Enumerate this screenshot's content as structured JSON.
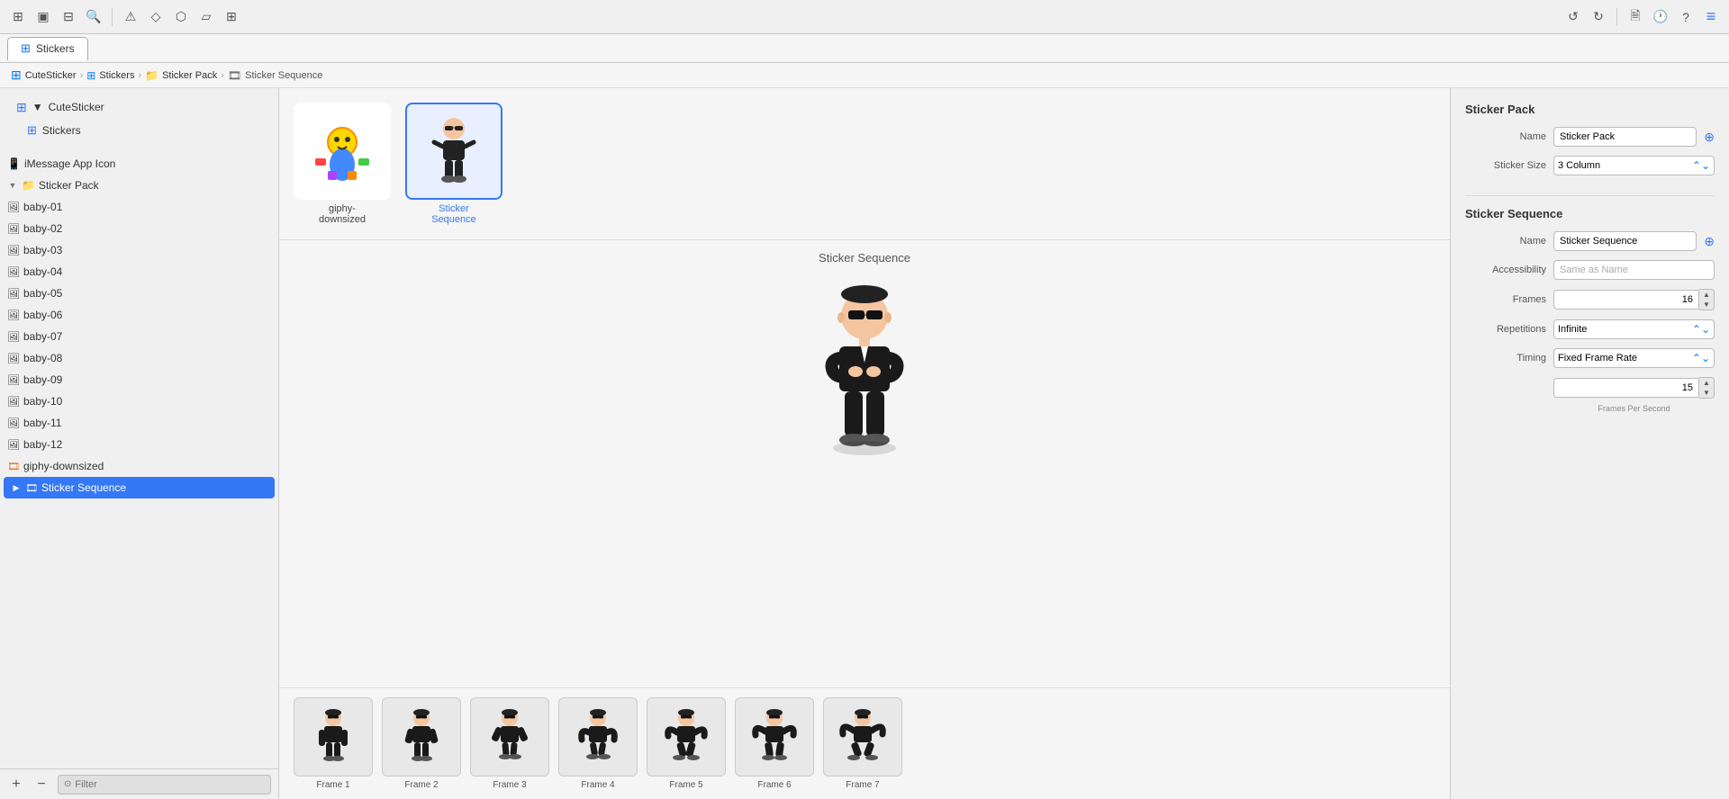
{
  "app": {
    "title": "CuteSticker"
  },
  "toolbar": {
    "icons": [
      "square-icon",
      "window-icon",
      "panel-icon",
      "search-icon",
      "warning-icon",
      "diamond-icon",
      "brush-icon",
      "rect-icon",
      "grid-icon"
    ]
  },
  "tabs": [
    {
      "id": "stickers",
      "label": "Stickers",
      "active": true
    }
  ],
  "breadcrumb": {
    "items": [
      "CuteSticker",
      "Stickers",
      "Sticker Pack",
      "Sticker Sequence"
    ]
  },
  "nav": {
    "cute_sticker_label": "CuteSticker",
    "stickers_label": "Stickers"
  },
  "tree": {
    "imessage_label": "iMessage App Icon",
    "sticker_pack_label": "Sticker Pack",
    "items": [
      "baby-01",
      "baby-02",
      "baby-03",
      "baby-04",
      "baby-05",
      "baby-06",
      "baby-07",
      "baby-08",
      "baby-09",
      "baby-10",
      "baby-11",
      "baby-12",
      "giphy-downsized",
      "Sticker Sequence"
    ]
  },
  "asset_grid": {
    "items": [
      {
        "id": "giphy",
        "label": "giphy-\ndownsized",
        "selected": false
      },
      {
        "id": "sticker-seq",
        "label": "Sticker\nSequence",
        "selected": true
      }
    ]
  },
  "preview": {
    "title": "Sticker Sequence"
  },
  "frames": [
    "Frame 1",
    "Frame 2",
    "Frame 3",
    "Frame 4",
    "Frame 5",
    "Frame 6",
    "Frame 7"
  ],
  "right_panel": {
    "sticker_pack_section": "Sticker Pack",
    "name_label": "Name",
    "name_value": "Sticker Pack",
    "sticker_size_label": "Sticker Size",
    "sticker_size_value": "3 Column",
    "sticker_sequence_section": "Sticker Sequence",
    "seq_name_label": "Name",
    "seq_name_value": "Sticker Sequence",
    "accessibility_label": "Accessibility",
    "accessibility_placeholder": "Same as Name",
    "frames_label": "Frames",
    "frames_value": "16",
    "repetitions_label": "Repetitions",
    "repetitions_value": "Infinite",
    "timing_label": "Timing",
    "timing_value": "Fixed Frame Rate",
    "fps_value": "15",
    "fps_label": "Frames Per Second"
  },
  "filter": {
    "placeholder": "Filter"
  },
  "colors": {
    "accent": "#3478f6",
    "selected_bg": "#3478f6"
  }
}
